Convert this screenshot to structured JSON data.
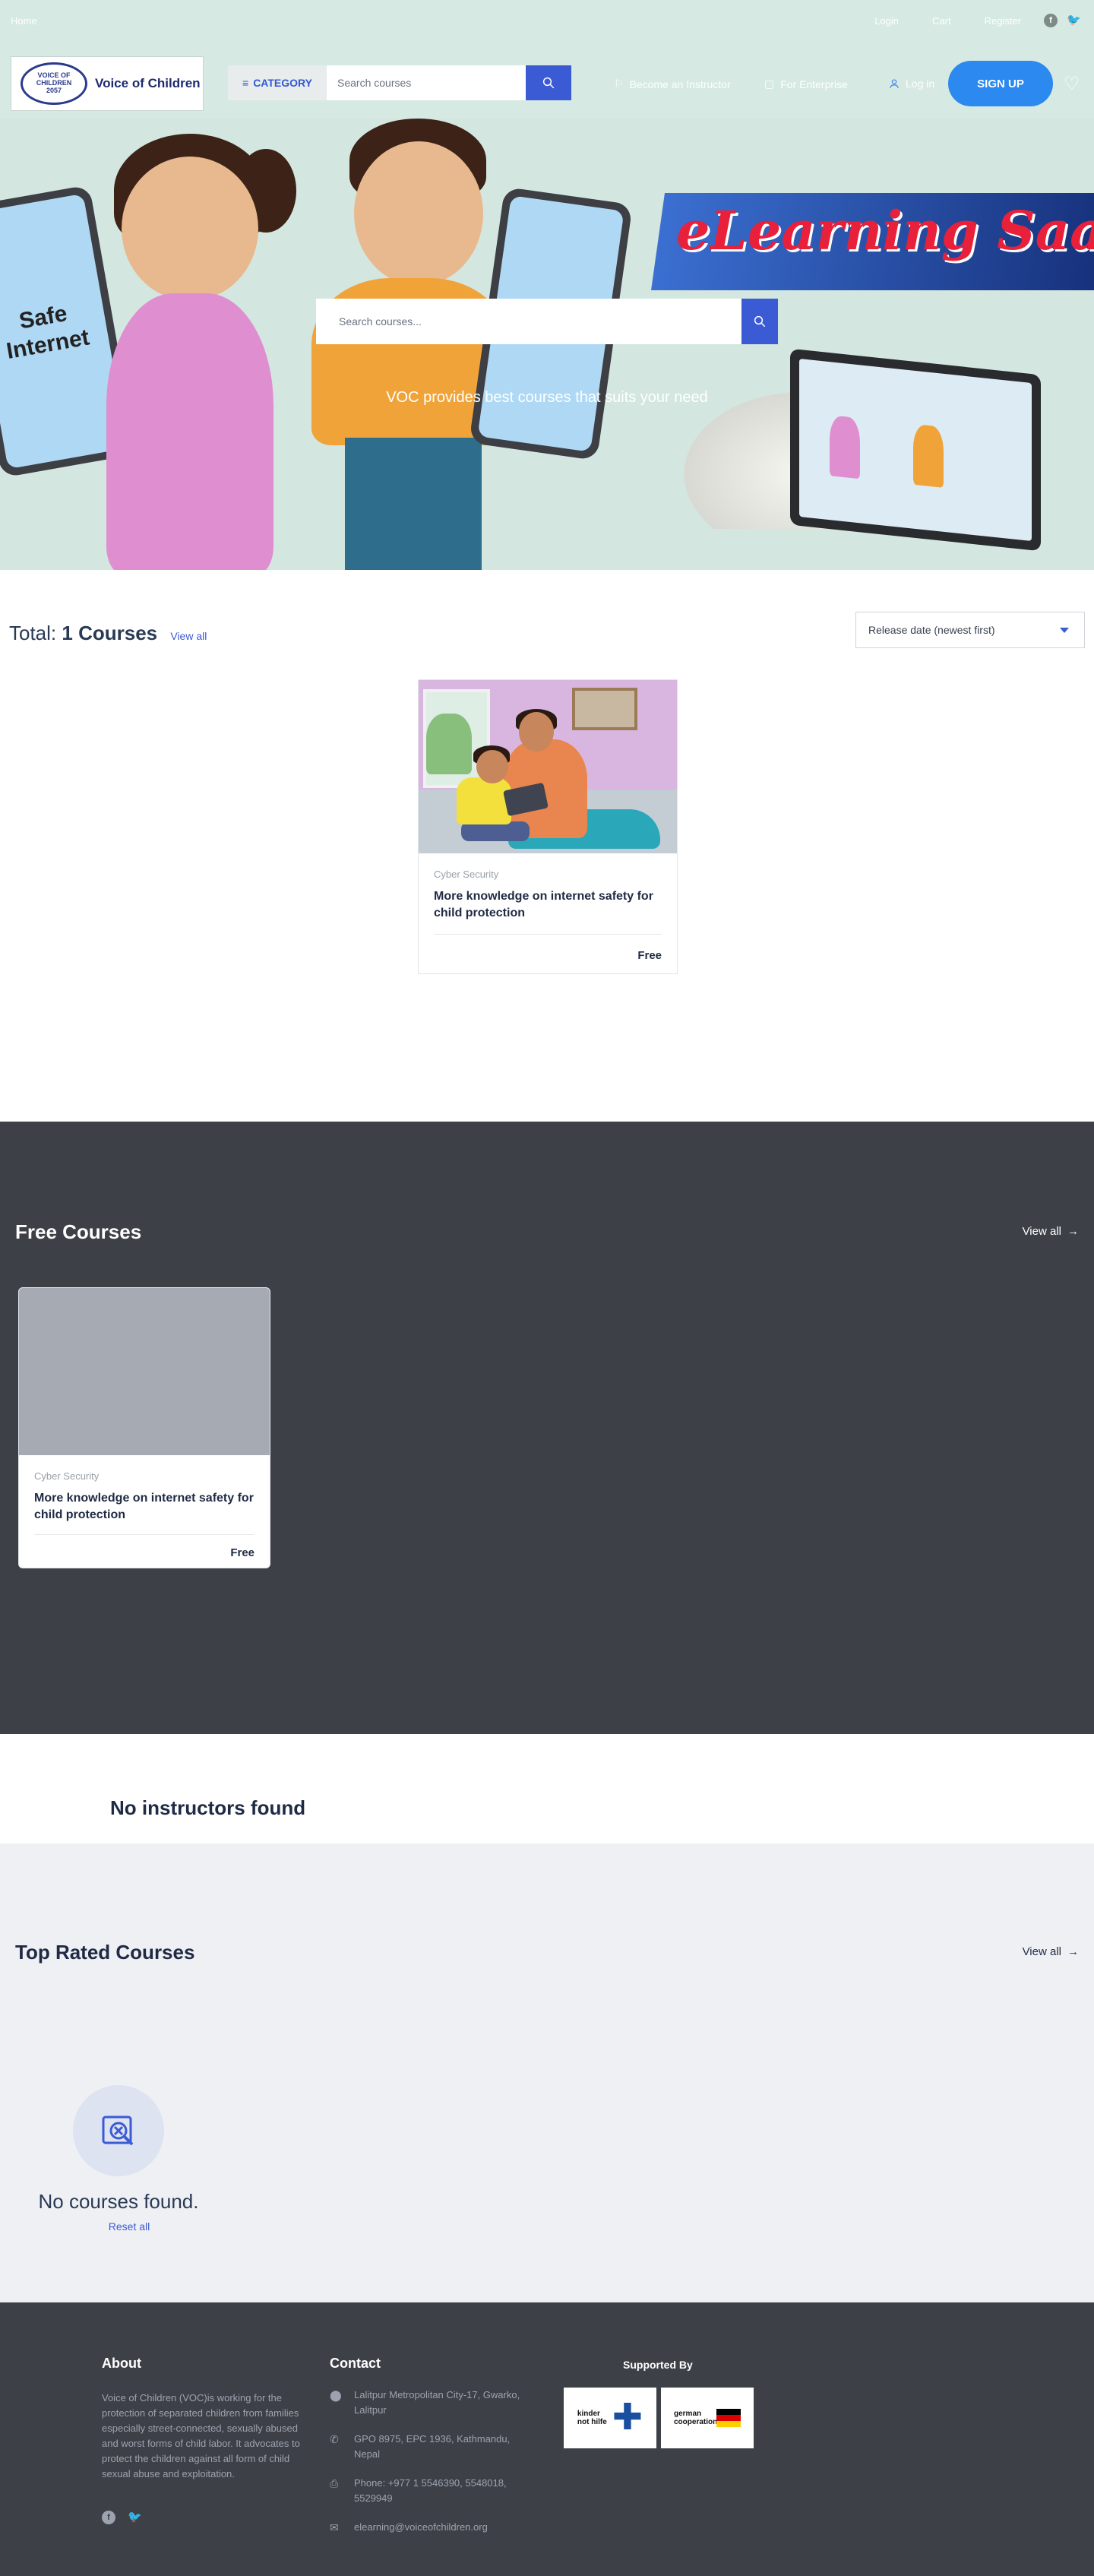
{
  "topstrip": {
    "left_text": "Home",
    "links": [
      "Login",
      "Cart",
      "Register"
    ],
    "social": [
      "facebook-icon",
      "twitter-icon"
    ]
  },
  "header": {
    "logo_text": "Voice of Children",
    "logo_seal_top": "VOICE OF CHILDREN",
    "logo_seal_year": "2057",
    "category_label": "CATEGORY",
    "search_placeholder": "Search courses",
    "become_instructor": "Become an Instructor",
    "for_enterprise": "For Enterprise",
    "login": "Log in",
    "signup": "SIGN UP"
  },
  "hero": {
    "phone_left_text": "Safe Internet",
    "banner_title": "eLearning Saathi",
    "search_placeholder": "Search courses...",
    "tagline": "VOC provides best courses that suits your need"
  },
  "courses_section": {
    "total_prefix": "Total:",
    "total_count": "1 Courses",
    "view_all": "View all",
    "sort_selected": "Release date (newest first)"
  },
  "course_card": {
    "category": "Cyber Security",
    "title": "More knowledge on internet safety for child protection",
    "price": "Free"
  },
  "free_courses": {
    "title": "Free Courses",
    "view_all": "View all",
    "card": {
      "category": "Cyber Security",
      "title": "More knowledge on internet safety for child protection",
      "price": "Free"
    }
  },
  "instructors": {
    "empty_text": "No instructors found"
  },
  "top_rated": {
    "title": "Top Rated Courses",
    "view_all": "View all",
    "empty_text": "No courses found.",
    "reset": "Reset all"
  },
  "footer": {
    "about_title": "About",
    "about_text": "Voice of Children (VOC)is working for the protection of separated children from families especially street-connected, sexually abused and worst forms of child labor. It advocates to protect the children against all form of child sexual abuse and exploitation.",
    "contact_title": "Contact",
    "address": "Lalitpur Metropolitan City-17, Gwarko, Lalitpur",
    "po_box": "GPO 8975, EPC 1936, Kathmandu, Nepal",
    "phone": "Phone: +977 1 5546390, 5548018, 5529949",
    "email": "elearning@voiceofchildren.org",
    "supported_by": "Supported By",
    "sponsor_1": "kinder not hilfe",
    "sponsor_2": "german cooperation"
  },
  "colors": {
    "header_bg": "#d6e9e2",
    "accent": "#3b5bd5",
    "signup": "#2b89f0",
    "dark_band": "#3d4046",
    "light_band": "#eef0f4"
  }
}
